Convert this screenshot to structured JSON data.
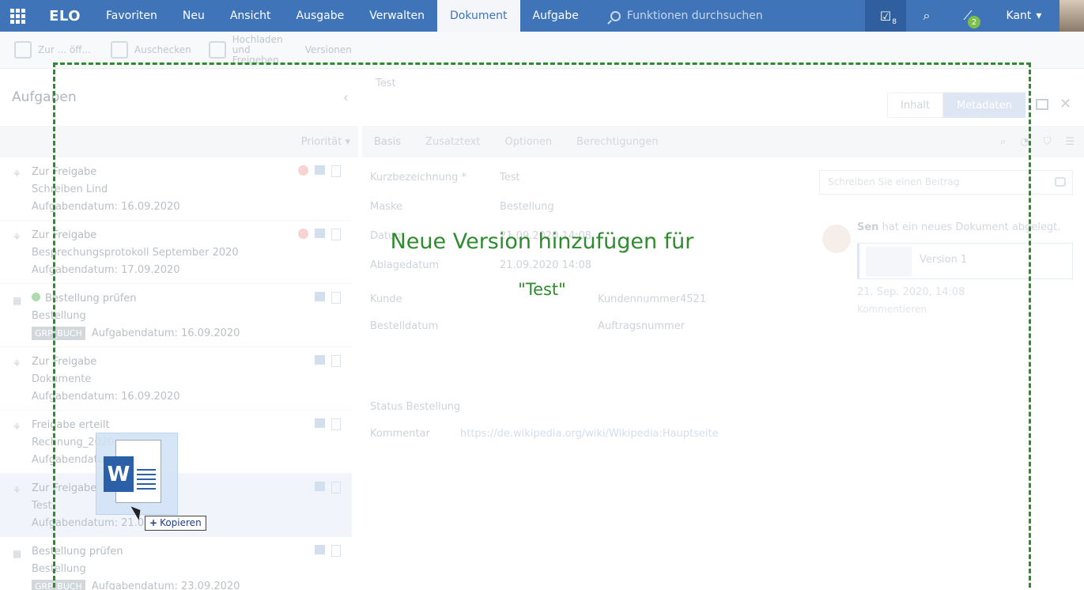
{
  "topbar": {
    "logo": "ELO",
    "menu": [
      "Favoriten",
      "Neu",
      "Ansicht",
      "Ausgabe",
      "Verwalten",
      "Dokument",
      "Aufgabe"
    ],
    "search_placeholder": "Funktionen durchsuchen",
    "tasks_badge": "8",
    "workflow_badge": "2",
    "user": "Kant"
  },
  "ribbon": {
    "buttons": [
      "Zur ... öff...",
      "Auschecken",
      "Hochladen und Freigeben",
      "Versionen"
    ]
  },
  "tasks_panel": {
    "title": "Aufgaben",
    "sort_label": "Priorität",
    "items": [
      {
        "line1": "Zur Freigabe",
        "line2": "Schreiben Lind",
        "line3": "Aufgabendatum: 16.09.2020"
      },
      {
        "line1": "Zur Freigabe",
        "line2": "Besprechungsprotokoll September 2020",
        "line3": "Aufgabendatum: 17.09.2020"
      },
      {
        "line1": "Bestellung prüfen",
        "line2": "Bestellung",
        "tag": "GRP_BUCH",
        "line3": "Aufgabendatum: 16.09.2020"
      },
      {
        "line1": "Zur Freigabe",
        "line2": "Dokumente",
        "line3": "Aufgabendatum: 16.09.2020"
      },
      {
        "line1": "Freigabe erteilt",
        "line2": "Rechnung_2020...",
        "line3": "Aufgabendatum: ..."
      },
      {
        "line1": "Zur Freigabe",
        "line2": "Test",
        "line3": "Aufgabendatum: 21.09.2..."
      },
      {
        "line1": "Bestellung prüfen",
        "line2": "Bestellung",
        "tag": "GRP_BUCH",
        "line3": "Aufgabendatum: 23.09.2020"
      }
    ]
  },
  "document": {
    "title": "Test",
    "view_toggle": [
      "Inhalt",
      "Metadaten"
    ],
    "tabs": [
      "Basis",
      "Zusatztext",
      "Optionen",
      "Berechtigungen"
    ],
    "fields": {
      "kurzbezeichnung_label": "Kurzbezeichnung *",
      "kurzbezeichnung_value": "Test",
      "maske_label": "Maske",
      "maske_value": "Bestellung",
      "datum_label": "Datum",
      "datum_value": "21.09.2020 14:08",
      "ablagedatum_label": "Ablagedatum",
      "ablagedatum_value": "21.09.2020 14:08",
      "kunde_label": "Kunde",
      "kundennummer_label": "Kundennummer",
      "kundennummer_value": "4521",
      "bestelldatum_label": "Bestelldatum",
      "auftragsnummer_label": "Auftragsnummer",
      "status_label": "Status Bestellung",
      "kommentar_label": "Kommentar",
      "kommentar_value": "https://de.wikipedia.org/wiki/Wikipedia:Hauptseite"
    }
  },
  "feed": {
    "input_placeholder": "Schreiben Sie einen Beitrag",
    "author": "Sen",
    "action": "hat ein neues Dokument abgelegt.",
    "card_label": "Version 1",
    "date": "21. Sep. 2020, 14:08",
    "comments": "Kommentieren"
  },
  "dropzone": {
    "title": "Neue Version hinzufügen für",
    "subtitle": "\"Test\"",
    "copy_tooltip": "Kopieren",
    "file_letter": "W"
  },
  "colors": {
    "nav_blue": "#3f74b8",
    "drop_green": "#2e8b2e"
  }
}
